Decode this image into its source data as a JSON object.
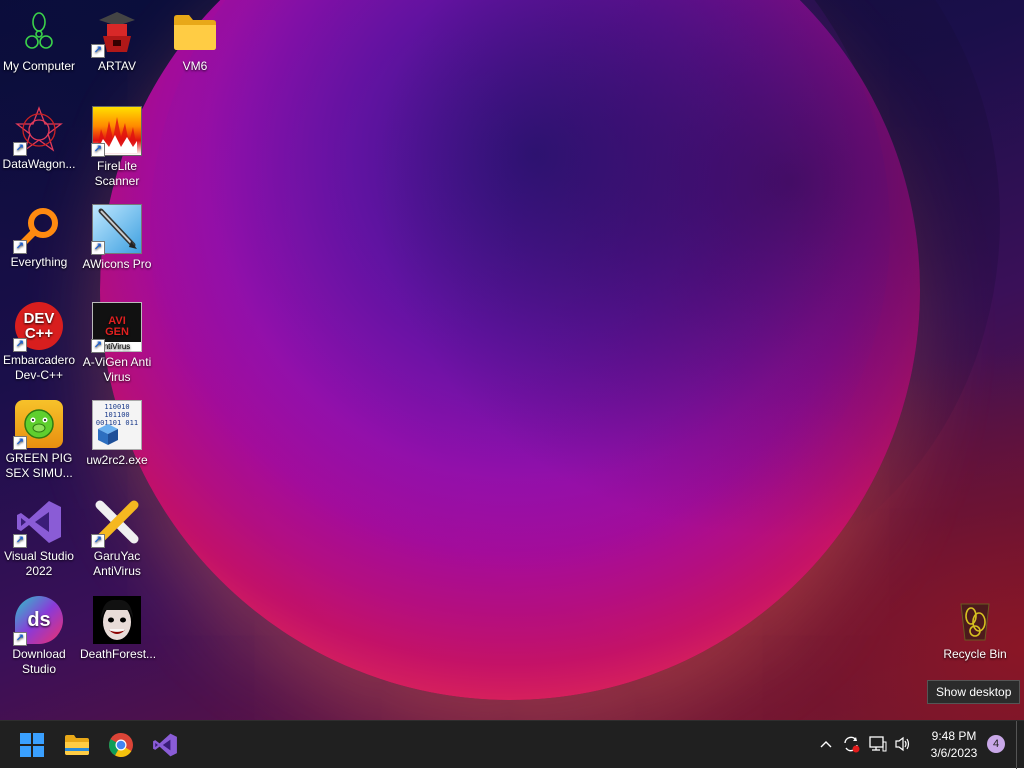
{
  "desktop_icons": [
    {
      "label": "My Computer",
      "icon": "my-computer-icon",
      "shortcut": false
    },
    {
      "label": "ARTAV",
      "icon": "artav-icon",
      "shortcut": true
    },
    {
      "label": "VM6",
      "icon": "folder-icon",
      "shortcut": false
    },
    {
      "label": "DataWagon...",
      "icon": "datawagon-icon",
      "shortcut": true
    },
    {
      "label": "FireLite Scanner",
      "icon": "firelite-scanner-icon",
      "shortcut": true
    },
    {
      "label": "Everything",
      "icon": "everything-search-icon",
      "shortcut": true
    },
    {
      "label": "AWicons Pro",
      "icon": "awicons-pro-icon",
      "shortcut": true
    },
    {
      "label": "Embarcadero Dev-C++",
      "icon": "devcpp-icon",
      "shortcut": true,
      "badge": "DEV C++"
    },
    {
      "label": "A-ViGen Anti Virus",
      "icon": "avigen-icon",
      "shortcut": true,
      "badge": "AVI GEN",
      "sub": "ntiVirus"
    },
    {
      "label": "GREEN PIG SEX SIMU...",
      "icon": "green-pig-icon",
      "shortcut": true
    },
    {
      "label": "uw2rc2.exe",
      "icon": "uw2rc2-exe-icon",
      "shortcut": false,
      "badge": "110010 101100 001101 011"
    },
    {
      "label": "Visual Studio 2022",
      "icon": "visual-studio-icon",
      "shortcut": true
    },
    {
      "label": "GaruYac AntiVirus",
      "icon": "garuyac-icon",
      "shortcut": true
    },
    {
      "label": "Download Studio",
      "icon": "download-studio-icon",
      "shortcut": true,
      "badge": "ds"
    },
    {
      "label": "DeathForest...",
      "icon": "deathforest-icon",
      "shortcut": false
    },
    {
      "label": "Recycle Bin",
      "icon": "recycle-bin-icon",
      "shortcut": false
    }
  ],
  "tooltip": "Show desktop",
  "taskbar": {
    "pinned": [
      "start-icon",
      "file-explorer-icon",
      "chrome-icon",
      "visual-studio-icon"
    ],
    "tray": {
      "time": "9:48 PM",
      "date": "3/6/2023",
      "notifications": "4"
    }
  },
  "colors": {
    "taskbar": "#202020",
    "accent": "#c9a8e8"
  }
}
